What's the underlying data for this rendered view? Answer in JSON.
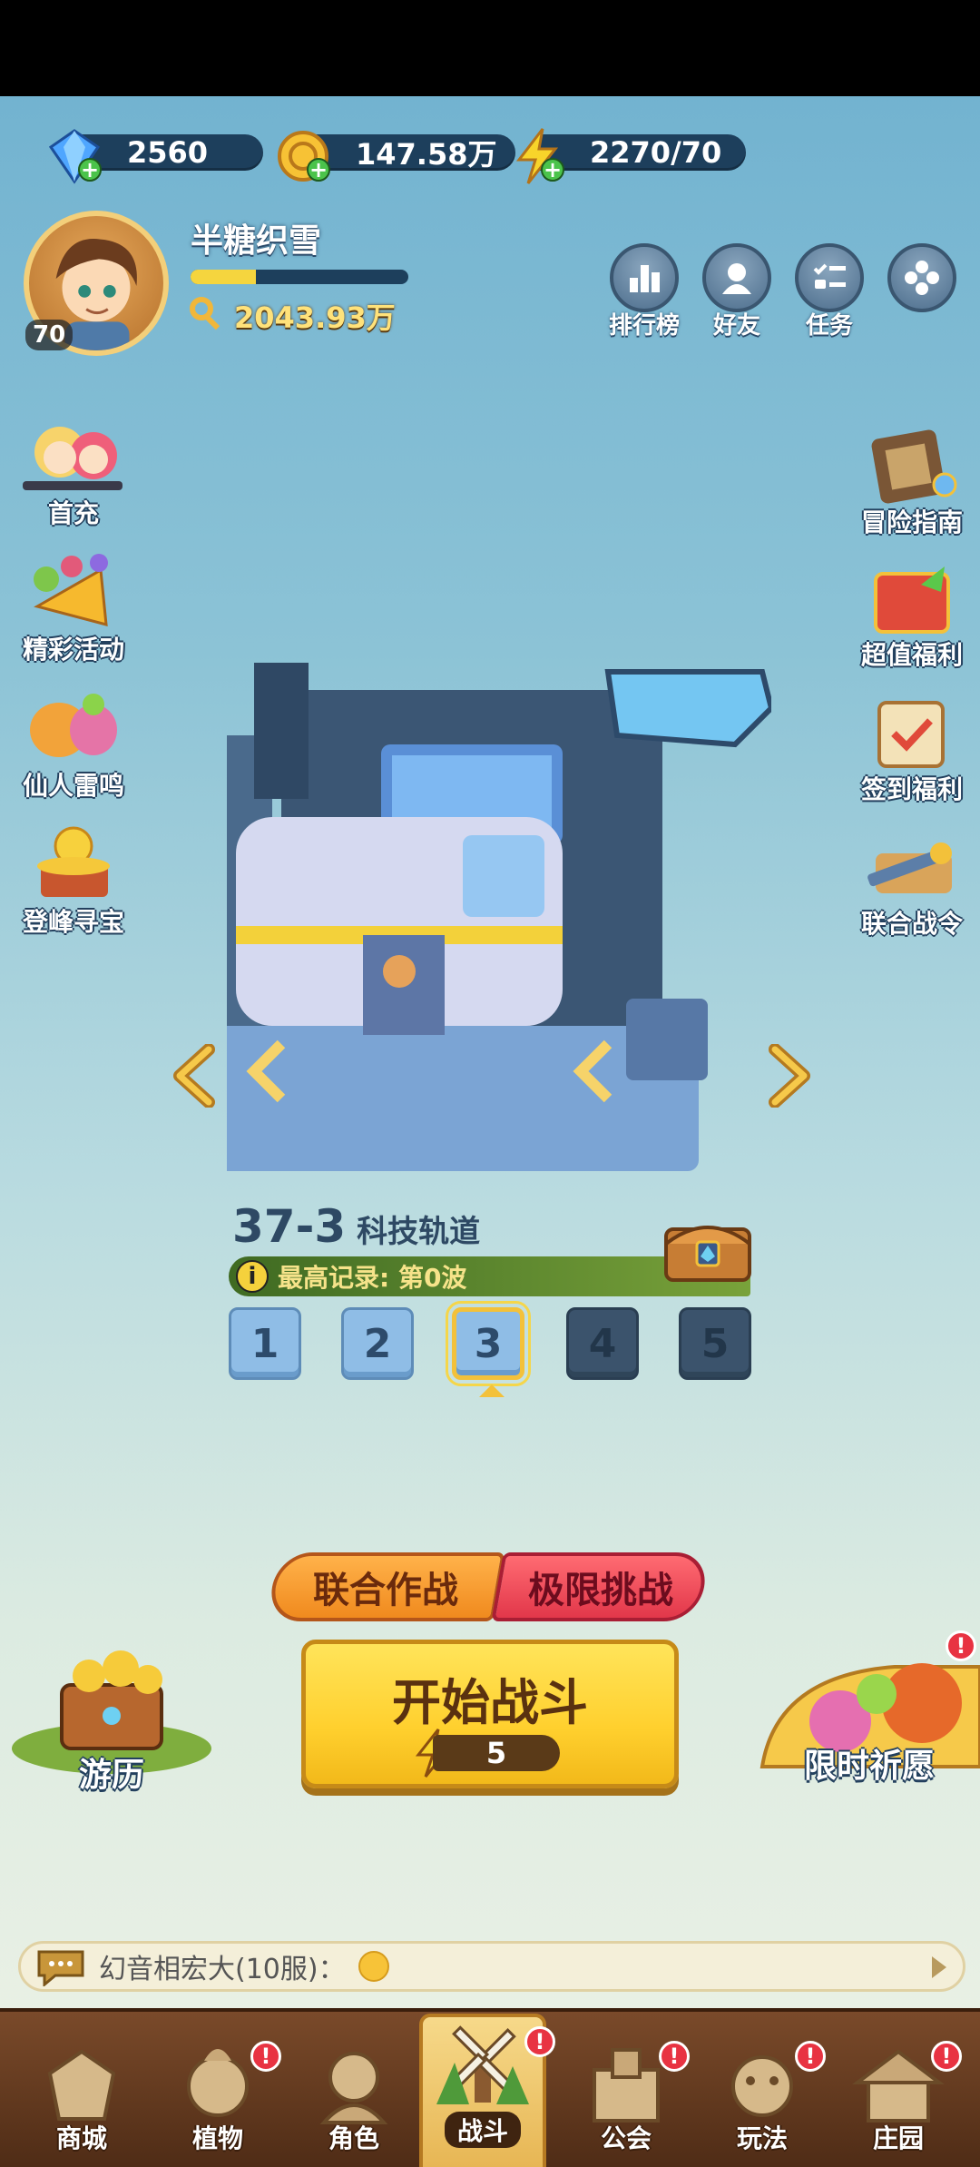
{
  "currencies": [
    {
      "name": "gem",
      "value": "2560"
    },
    {
      "name": "gold",
      "value": "147.58万"
    },
    {
      "name": "energy",
      "value": "2270/70"
    }
  ],
  "player": {
    "name": "半糖织雪",
    "level": "70",
    "xp_fraction": 0.3,
    "power": "2043.93万"
  },
  "top_buttons": [
    {
      "label": "排行榜",
      "icon": "ranking-icon"
    },
    {
      "label": "好友",
      "icon": "friends-icon"
    },
    {
      "label": "任务",
      "icon": "tasks-icon"
    },
    {
      "label": "",
      "icon": "more-menu-icon"
    }
  ],
  "left_menu": [
    "首充",
    "精彩活动",
    "仙人雷鸣",
    "登峰寻宝"
  ],
  "right_menu": [
    "冒险指南",
    "超值福利",
    "签到福利",
    "联合战令"
  ],
  "stage": {
    "number": "37-3",
    "name": "科技轨道",
    "record": "最高记录: 第0波",
    "waves": [
      "1",
      "2",
      "3",
      "4",
      "5"
    ],
    "selected_wave": "3"
  },
  "modes": {
    "coop": "联合作战",
    "extreme": "极限挑战"
  },
  "start": {
    "label": "开始战斗",
    "cost": "5"
  },
  "corner_left": "游历",
  "corner_right": "限时祈愿",
  "chat": {
    "text": "幻音相宏大(10服)："
  },
  "nav": [
    {
      "label": "商城",
      "badge": false
    },
    {
      "label": "植物",
      "badge": true
    },
    {
      "label": "角色",
      "badge": false
    },
    {
      "label": "战斗",
      "badge": true,
      "active": true
    },
    {
      "label": "公会",
      "badge": true
    },
    {
      "label": "玩法",
      "badge": true
    },
    {
      "label": "庄园",
      "badge": true
    }
  ],
  "colors": {
    "accent_yellow": "#ffd02e",
    "coop_orange": "#f08a1e",
    "extreme_red": "#e2374a",
    "badge_red": "#e83342"
  }
}
